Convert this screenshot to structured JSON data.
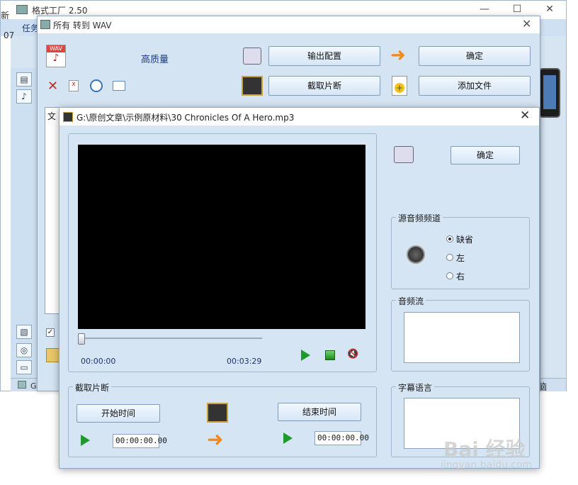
{
  "main_window": {
    "title": "格式工厂 2.50",
    "menu_first": "任务",
    "edge_text_top": "新",
    "edge_text_mid": "07",
    "status_path": "G:\\原创",
    "status_right": "脑",
    "controls": {
      "minimize": "—",
      "maximize": "☐",
      "close": "✕"
    }
  },
  "wav_dialog": {
    "title": "所有 转到 WAV",
    "close": "✕",
    "quality_label": "高质量",
    "output_config_label": "输出配置",
    "confirm_label": "确定",
    "clip_label": "截取片断",
    "add_file_label": "添加文件",
    "list_header": "文",
    "check_mark": "✓"
  },
  "clip_dialog": {
    "title": "G:\\原创文章\\示例原材料\\30 Chronicles Of A Hero.mp3",
    "close": "✕",
    "confirm_label": "确定",
    "player": {
      "time_start": "00:00:00",
      "time_total": "00:03:29",
      "position_fraction": 0
    },
    "source_channel": {
      "label": "源音频频道",
      "options": [
        "缺省",
        "左",
        "右"
      ],
      "selected": "缺省"
    },
    "audio_stream": {
      "label": "音频流"
    },
    "subtitle_language": {
      "label": "字幕语言"
    },
    "clip_section": {
      "label": "截取片断",
      "start_button": "开始时间",
      "end_button": "结束时间",
      "start_time": "00:00:00.00",
      "end_time": "00:00:00.00"
    }
  },
  "watermark": {
    "text": "Bai 经验",
    "sub": "jingyan.baidu.com"
  },
  "colors": {
    "accent": "#1f9a2d",
    "dialog_bg": "#d6e5f4",
    "video_bg": "#000000"
  }
}
